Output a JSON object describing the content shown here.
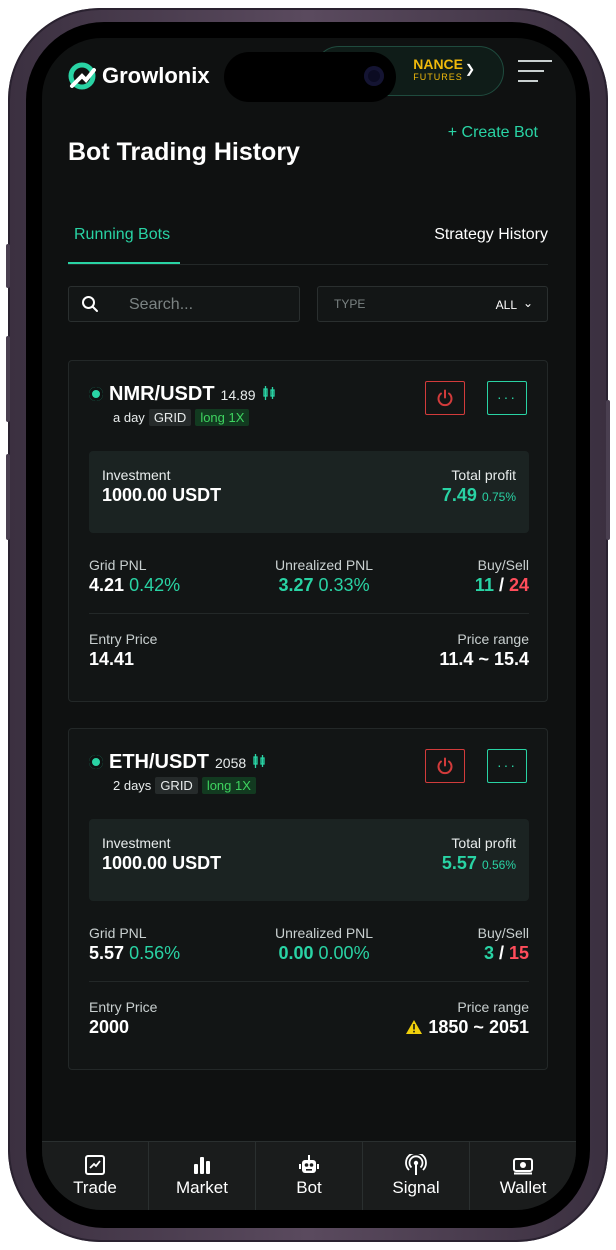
{
  "header": {
    "brand": "Growlonix",
    "exchange_line1": "NANCE",
    "exchange_line2": "FUTURES"
  },
  "page": {
    "title": "Bot Trading History",
    "create_label": "+ Create Bot"
  },
  "tabs": [
    {
      "label": "Running Bots",
      "active": true
    },
    {
      "label": "Strategy History",
      "active": false
    }
  ],
  "filters": {
    "search_placeholder": "Search...",
    "type_label": "TYPE",
    "type_value": "ALL"
  },
  "labels": {
    "investment": "Investment",
    "total_profit": "Total profit",
    "grid_pnl": "Grid PNL",
    "unrealized_pnl": "Unrealized PNL",
    "buy_sell": "Buy/Sell",
    "entry_price": "Entry Price",
    "price_range": "Price range"
  },
  "bots": [
    {
      "pair": "NMR/USDT",
      "price": "14.89",
      "age": "a day",
      "type": "GRID",
      "side": "long 1X",
      "investment": "1000.00 USDT",
      "total_profit": "7.49",
      "total_profit_pct": "0.75%",
      "grid_pnl": "4.21",
      "grid_pnl_pct": "0.42%",
      "unrealized_pnl": "3.27",
      "unrealized_pnl_pct": "0.33%",
      "buy": "11",
      "sell": "24",
      "entry_price": "14.41",
      "price_range": "11.4 ~ 15.4"
    },
    {
      "pair": "ETH/USDT",
      "price": "2058",
      "age": "2 days",
      "type": "GRID",
      "side": "long 1X",
      "investment": "1000.00 USDT",
      "total_profit": "5.57",
      "total_profit_pct": "0.56%",
      "grid_pnl": "5.57",
      "grid_pnl_pct": "0.56%",
      "unrealized_pnl": "0.00",
      "unrealized_pnl_pct": "0.00%",
      "buy": "3",
      "sell": "15",
      "entry_price": "2000",
      "price_range": "1850 ~ 2051"
    }
  ],
  "bottom_nav": [
    {
      "label": "Trade",
      "icon": "chart-icon"
    },
    {
      "label": "Market",
      "icon": "bars-icon"
    },
    {
      "label": "Bot",
      "icon": "robot-icon"
    },
    {
      "label": "Signal",
      "icon": "signal-icon"
    },
    {
      "label": "Wallet",
      "icon": "wallet-icon"
    }
  ],
  "colors": {
    "accent": "#29d3a4",
    "danger": "#ff4d5b",
    "background": "#0f1111",
    "binance_yellow": "#f0b90b"
  }
}
